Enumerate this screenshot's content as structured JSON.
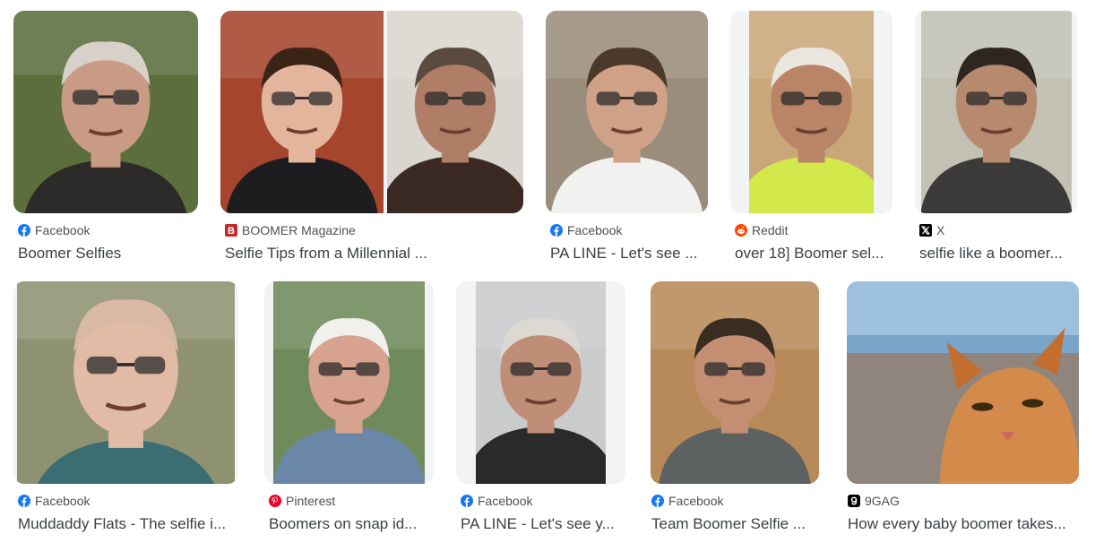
{
  "results": [
    {
      "source": "Facebook",
      "icon": "facebook-icon",
      "title": "Boomer Selfies",
      "bg": "#5b6e3c",
      "skin": "#c99b84",
      "shirt": "#2d2a2a",
      "hair": "#d8d1c9"
    },
    {
      "source": "BOOMER Magazine",
      "icon": "boomer-magazine-icon",
      "title": "Selfie Tips from a Millennial ...",
      "bg": "#a6452d",
      "skin": "#e3b59c",
      "shirt": "#1d1d1f",
      "hair": "#3b2416"
    },
    {
      "source": "Facebook",
      "icon": "facebook-icon",
      "title": "PA LINE - Let's see ...",
      "bg": "#9a8d7c",
      "skin": "#cfa288",
      "shirt": "#f1f1ef",
      "hair": "#4b3a2a"
    },
    {
      "source": "Reddit",
      "icon": "reddit-icon",
      "title": "over 18] Boomer sel...",
      "bg": "#c9a77a",
      "skin": "#b98566",
      "shirt": "#d3e84a",
      "hair": "#e9e6df"
    },
    {
      "source": "X",
      "icon": "x-icon",
      "title": "selfie like a boomer...",
      "bg": "#c2c1b3",
      "skin": "#b78a70",
      "shirt": "#3c3a38",
      "hair": "#2f2620"
    },
    {
      "source": "Facebook",
      "icon": "facebook-icon",
      "title": "Muddaddy Flats - The selfie i...",
      "bg": "#8f9270",
      "skin": "#e2bba7",
      "shirt": "#3b6e73",
      "hair": "#d9b8a5"
    },
    {
      "source": "Pinterest",
      "icon": "pinterest-icon",
      "title": "Boomers on snap id...",
      "bg": "#6f8a5b",
      "skin": "#d7a38e",
      "shirt": "#6a87a8",
      "hair": "#f1f0ed"
    },
    {
      "source": "Facebook",
      "icon": "facebook-icon",
      "title": "PA LINE - Let's see y...",
      "bg": "#c9cbcd",
      "skin": "#c08d76",
      "shirt": "#2a2a2a",
      "hair": "#dcd8d2"
    },
    {
      "source": "Facebook",
      "icon": "facebook-icon",
      "title": "Team Boomer Selfie ...",
      "bg": "#b88a5a",
      "skin": "#c38e72",
      "shirt": "#5e6161",
      "hair": "#3a2c22"
    },
    {
      "source": "9GAG",
      "icon": "9gag-icon",
      "title": "How every baby boomer takes...",
      "bg": "#9cc0de",
      "skin": "#d48a4a",
      "shirt": "#8f857d",
      "hair": "#c26e2f"
    }
  ],
  "colors": {
    "facebook": "#1877f2",
    "reddit": "#ff4500",
    "pinterest": "#e60023",
    "boomer": "#c62828",
    "x": "#000000",
    "ninegag": "#000000"
  }
}
